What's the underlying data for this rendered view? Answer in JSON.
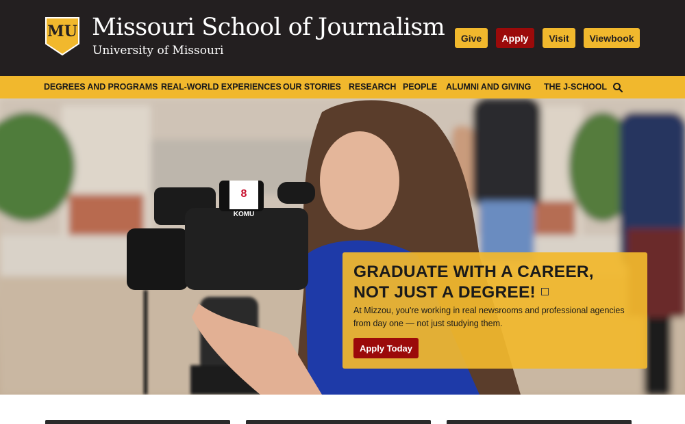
{
  "header": {
    "logo_text": "MU",
    "title": "Missouri School of Journalism",
    "subtitle": "University of Missouri",
    "utility_links": [
      {
        "label": "Give"
      },
      {
        "label": "Apply"
      },
      {
        "label": "Visit"
      },
      {
        "label": "Viewbook"
      }
    ]
  },
  "nav": {
    "items": [
      {
        "label": "DEGREES AND PROGRAMS"
      },
      {
        "label": "REAL-WORLD EXPERIENCES"
      },
      {
        "label": "OUR STORIES"
      },
      {
        "label": "RESEARCH"
      },
      {
        "label": "PEOPLE"
      },
      {
        "label": "ALUMNI AND GIVING"
      },
      {
        "label": "THE J-SCHOOL"
      }
    ],
    "search_icon": "search-icon"
  },
  "hero": {
    "camera_mic_label": "KOMU",
    "camera_channel": "8",
    "cta": {
      "title": "GRADUATE WITH A CAREER, NOT JUST A DEGREE!",
      "body": "At Mizzou, you're working in real newsrooms and professional agencies from day one — not just studying them.",
      "button": "Apply Today",
      "pause_icon": "pause-icon"
    }
  },
  "colors": {
    "brand_black": "#231f20",
    "brand_gold": "#f1b82d",
    "brand_red": "#9b0a0a"
  }
}
